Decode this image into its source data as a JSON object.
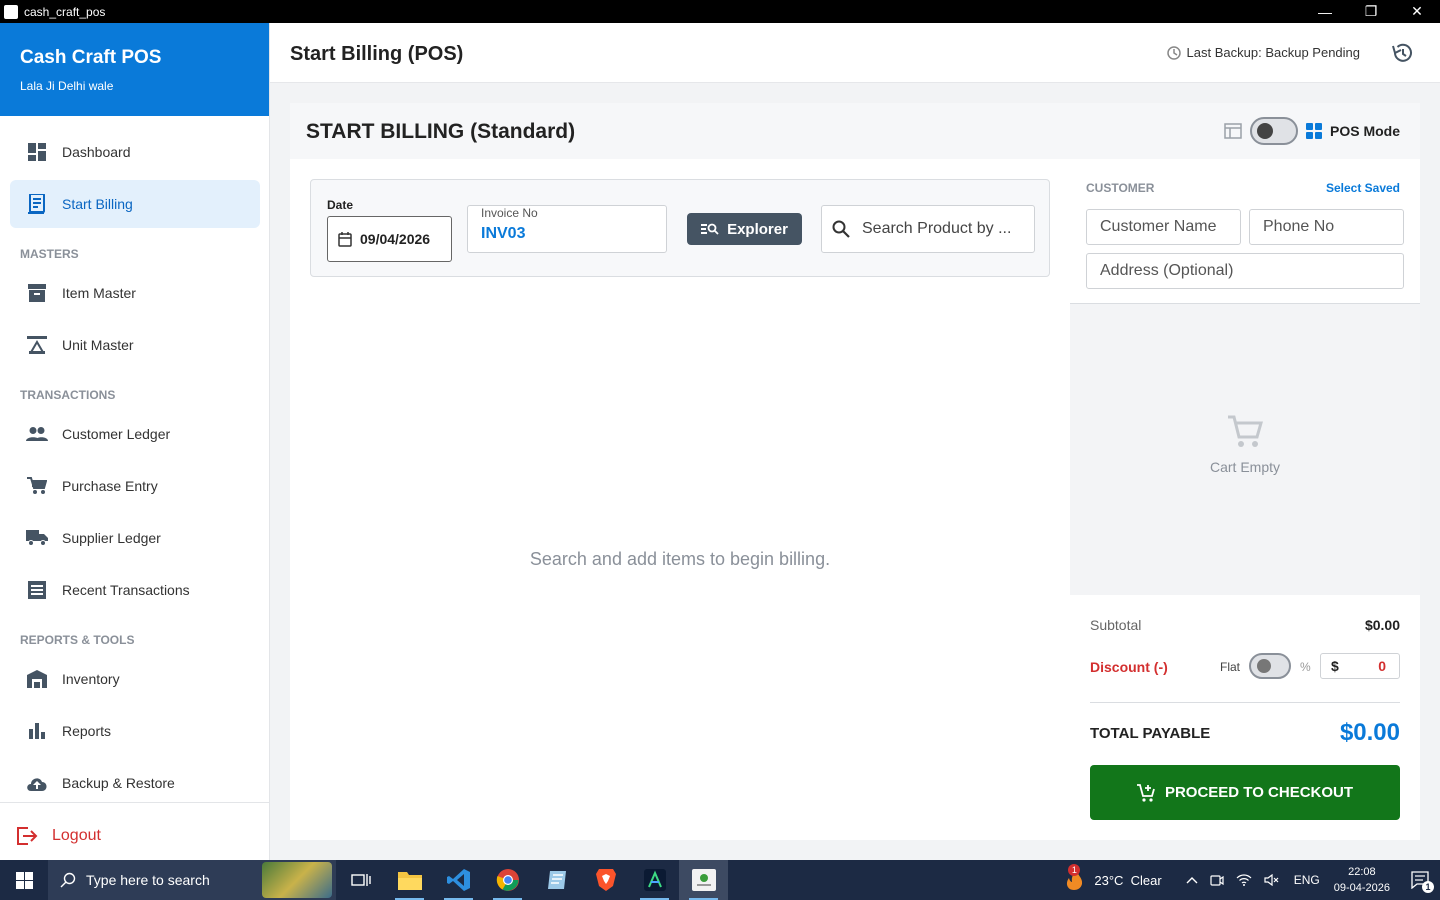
{
  "window": {
    "title": "cash_craft_pos",
    "minimize": "—",
    "restore": "❐",
    "close": "✕"
  },
  "sidebar": {
    "brand": "Cash Craft POS",
    "subtitle": "Lala Ji Delhi wale",
    "items": [
      {
        "label": "Dashboard",
        "icon": "dashboard-icon"
      },
      {
        "label": "Start Billing",
        "icon": "receipt-icon",
        "active": true
      },
      {
        "section": "MASTERS"
      },
      {
        "label": "Item Master",
        "icon": "archive-icon"
      },
      {
        "label": "Unit Master",
        "icon": "scale-icon"
      },
      {
        "section": "TRANSACTIONS"
      },
      {
        "label": "Customer Ledger",
        "icon": "people-icon"
      },
      {
        "label": "Purchase Entry",
        "icon": "cart-icon"
      },
      {
        "label": "Supplier Ledger",
        "icon": "truck-icon"
      },
      {
        "label": "Recent Transactions",
        "icon": "list-icon"
      },
      {
        "section": "REPORTS & TOOLS"
      },
      {
        "label": "Inventory",
        "icon": "warehouse-icon"
      },
      {
        "label": "Reports",
        "icon": "bar-chart-icon"
      },
      {
        "label": "Backup & Restore",
        "icon": "cloud-upload-icon"
      }
    ],
    "logout": "Logout"
  },
  "header": {
    "title": "Start Billing (POS)",
    "backup_status": "Last Backup: Backup Pending"
  },
  "billing": {
    "heading": "START BILLING (Standard)",
    "mode_label": "POS Mode",
    "date_label": "Date",
    "date_value": "09/04/2026",
    "invoice_label": "Invoice No",
    "invoice_value": "INV03",
    "explorer_label": "Explorer",
    "search_placeholder": "Search Product by ...",
    "empty_message": "Search and add items to begin billing."
  },
  "customer": {
    "label": "CUSTOMER",
    "select_saved": "Select Saved",
    "name_placeholder": "Customer Name",
    "phone_placeholder": "Phone No",
    "address_placeholder": "Address (Optional)"
  },
  "cart": {
    "empty_text": "Cart Empty"
  },
  "totals": {
    "subtotal_label": "Subtotal",
    "subtotal_value": "$0.00",
    "discount_label": "Discount (-)",
    "flat_label": "Flat",
    "percent_label": "%",
    "currency_symbol": "$",
    "discount_value": "0",
    "total_label": "TOTAL PAYABLE",
    "total_value": "$0.00",
    "checkout_label": "PROCEED TO CHECKOUT"
  },
  "taskbar": {
    "search_placeholder": "Type here to search",
    "weather": "23°C  Clear",
    "weather_badge": "1",
    "language": "ENG",
    "time": "22:08",
    "date": "09-04-2026",
    "notification_count": "1"
  },
  "colors": {
    "accent": "#0a7ad9",
    "checkout": "#12761a",
    "danger": "#d32f2f",
    "taskbar": "#1c2a44"
  }
}
